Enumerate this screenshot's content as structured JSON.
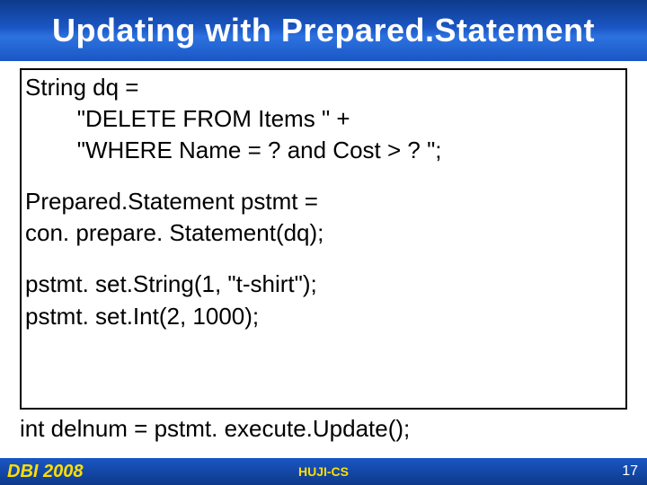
{
  "title": "Updating with Prepared.Statement",
  "code": {
    "l1": "String dq = ",
    "l2": "        \"DELETE FROM Items \" +",
    "l3": "        \"WHERE Name = ? and Cost > ? \";",
    "l4": "Prepared.Statement pstmt = ",
    "l5": "con. prepare. Statement(dq);",
    "l6": "pstmt. set.String(1, \"t-shirt\");",
    "l7": "pstmt. set.Int(2, 1000);",
    "l8": "int delnum = pstmt. execute.Update();"
  },
  "footer": {
    "left": "DBI 2008",
    "center": "HUJI-CS",
    "page": "17"
  }
}
